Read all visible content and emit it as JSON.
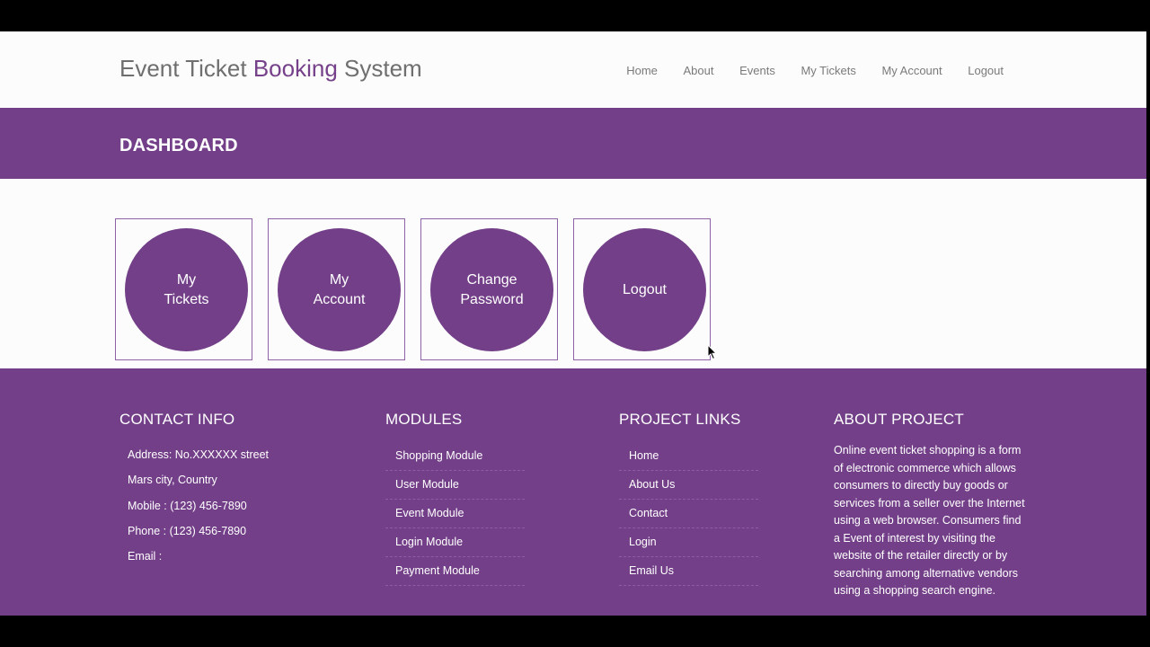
{
  "header": {
    "title_part1": "Event Ticket ",
    "title_part2": "Booking",
    "title_part3": " System",
    "nav": [
      "Home",
      "About",
      "Events",
      "My Tickets",
      "My Account",
      "Logout"
    ]
  },
  "banner": {
    "title": "DASHBOARD"
  },
  "tiles": [
    {
      "line1": "My",
      "line2": "Tickets"
    },
    {
      "line1": "My",
      "line2": "Account"
    },
    {
      "line1": "Change",
      "line2": "Password"
    },
    {
      "line1": "Logout",
      "line2": ""
    }
  ],
  "footer": {
    "contact": {
      "heading": "CONTACT INFO",
      "lines": [
        "Address: No.XXXXXX street",
        "Mars city, Country",
        "Mobile : (123) 456-7890",
        "Phone : (123) 456-7890",
        "Email :"
      ]
    },
    "modules": {
      "heading": "MODULES",
      "items": [
        "Shopping Module",
        "User Module",
        "Event Module",
        "Login Module",
        "Payment Module"
      ]
    },
    "project_links": {
      "heading": "PROJECT LINKS",
      "items": [
        "Home",
        "About Us",
        "Contact",
        "Login",
        "Email Us"
      ]
    },
    "about": {
      "heading": "ABOUT PROJECT",
      "text": "Online event ticket shopping is a form of electronic commerce which allows consumers to directly buy goods or services from a seller over the Internet using a web browser. Consumers find a Event of interest by visiting the website of the retailer directly or by searching among alternative vendors using a shopping search engine."
    }
  },
  "colors": {
    "brand": "#733f88",
    "background": "#fbfcfb"
  }
}
